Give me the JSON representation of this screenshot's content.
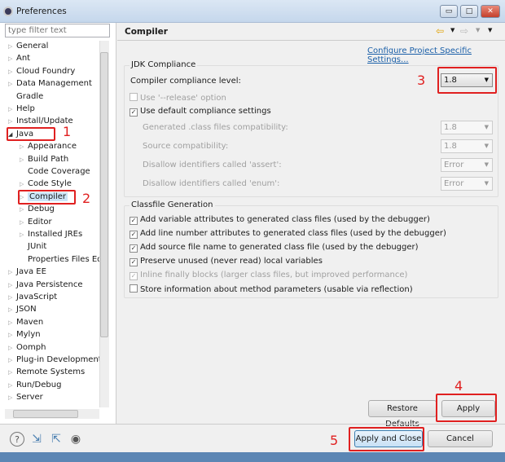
{
  "window": {
    "title": "Preferences",
    "minimize": "▭",
    "maximize": "□",
    "close": "✕"
  },
  "filter": {
    "placeholder": "type filter text"
  },
  "tree": [
    {
      "label": "General",
      "indent": 0,
      "arrow": "closed"
    },
    {
      "label": "Ant",
      "indent": 0,
      "arrow": "closed"
    },
    {
      "label": "Cloud Foundry",
      "indent": 0,
      "arrow": "closed"
    },
    {
      "label": "Data Management",
      "indent": 0,
      "arrow": "closed"
    },
    {
      "label": "Gradle",
      "indent": 0,
      "arrow": "none"
    },
    {
      "label": "Help",
      "indent": 0,
      "arrow": "closed"
    },
    {
      "label": "Install/Update",
      "indent": 0,
      "arrow": "closed"
    },
    {
      "label": "Java",
      "indent": 0,
      "arrow": "open"
    },
    {
      "label": "Appearance",
      "indent": 1,
      "arrow": "closed"
    },
    {
      "label": "Build Path",
      "indent": 1,
      "arrow": "closed"
    },
    {
      "label": "Code Coverage",
      "indent": 1,
      "arrow": "none"
    },
    {
      "label": "Code Style",
      "indent": 1,
      "arrow": "closed"
    },
    {
      "label": "Compiler",
      "indent": 1,
      "arrow": "closed",
      "selected": true
    },
    {
      "label": "Debug",
      "indent": 1,
      "arrow": "closed"
    },
    {
      "label": "Editor",
      "indent": 1,
      "arrow": "closed"
    },
    {
      "label": "Installed JREs",
      "indent": 1,
      "arrow": "closed"
    },
    {
      "label": "JUnit",
      "indent": 1,
      "arrow": "none"
    },
    {
      "label": "Properties Files Edi",
      "indent": 1,
      "arrow": "none"
    },
    {
      "label": "Java EE",
      "indent": 0,
      "arrow": "closed"
    },
    {
      "label": "Java Persistence",
      "indent": 0,
      "arrow": "closed"
    },
    {
      "label": "JavaScript",
      "indent": 0,
      "arrow": "closed"
    },
    {
      "label": "JSON",
      "indent": 0,
      "arrow": "closed"
    },
    {
      "label": "Maven",
      "indent": 0,
      "arrow": "closed"
    },
    {
      "label": "Mylyn",
      "indent": 0,
      "arrow": "closed"
    },
    {
      "label": "Oomph",
      "indent": 0,
      "arrow": "closed"
    },
    {
      "label": "Plug-in Development",
      "indent": 0,
      "arrow": "closed"
    },
    {
      "label": "Remote Systems",
      "indent": 0,
      "arrow": "closed"
    },
    {
      "label": "Run/Debug",
      "indent": 0,
      "arrow": "closed"
    },
    {
      "label": "Server",
      "indent": 0,
      "arrow": "closed"
    }
  ],
  "page": {
    "title": "Compiler",
    "link": "Configure Project Specific Settings...",
    "jdk": {
      "group": "JDK Compliance",
      "level_label": "Compiler compliance level:",
      "level_value": "1.8",
      "release": "Use '--release' option",
      "use_default": "Use default compliance settings",
      "rows": [
        {
          "label": "Generated .class files compatibility:",
          "value": "1.8"
        },
        {
          "label": "Source compatibility:",
          "value": "1.8"
        },
        {
          "label": "Disallow identifiers called 'assert':",
          "value": "Error"
        },
        {
          "label": "Disallow identifiers called 'enum':",
          "value": "Error"
        }
      ]
    },
    "classfile": {
      "group": "Classfile Generation",
      "items": [
        {
          "label": "Add variable attributes to generated class files (used by the debugger)",
          "checked": true,
          "disabled": false
        },
        {
          "label": "Add line number attributes to generated class files (used by the debugger)",
          "checked": true,
          "disabled": false
        },
        {
          "label": "Add source file name to generated class file (used by the debugger)",
          "checked": true,
          "disabled": false
        },
        {
          "label": "Preserve unused (never read) local variables",
          "checked": true,
          "disabled": false
        },
        {
          "label": "Inline finally blocks (larger class files, but improved performance)",
          "checked": true,
          "disabled": true
        },
        {
          "label": "Store information about method parameters (usable via reflection)",
          "checked": false,
          "disabled": false
        }
      ]
    }
  },
  "buttons": {
    "restore": "Restore Defaults",
    "apply": "Apply",
    "apply_close": "Apply and Close",
    "cancel": "Cancel"
  },
  "annotations": [
    "1",
    "2",
    "3",
    "4",
    "5"
  ],
  "colors": {
    "annotation": "#e02020",
    "link": "#1a5fa8",
    "selection": "#cce4f7"
  }
}
